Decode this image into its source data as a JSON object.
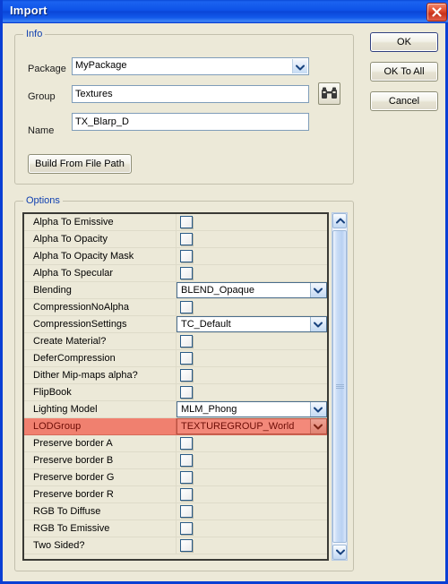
{
  "window": {
    "title": "Import",
    "close_icon": "close-x-icon"
  },
  "info": {
    "legend": "Info",
    "package": {
      "label": "Package",
      "value": "MyPackage",
      "icon": "chevron-down-icon"
    },
    "group": {
      "label": "Group",
      "value": "Textures",
      "browse_icon": "binoculars-icon"
    },
    "name": {
      "label": "Name",
      "value": "TX_Blarp_D"
    },
    "build_button": "Build From File Path"
  },
  "actions": {
    "ok": "OK",
    "ok_to_all": "OK To All",
    "cancel": "Cancel"
  },
  "options": {
    "legend": "Options",
    "rows": [
      {
        "name": "Alpha To Emissive",
        "type": "checkbox",
        "checked": false
      },
      {
        "name": "Alpha To Opacity",
        "type": "checkbox",
        "checked": false
      },
      {
        "name": "Alpha To Opacity Mask",
        "type": "checkbox",
        "checked": false
      },
      {
        "name": "Alpha To Specular",
        "type": "checkbox",
        "checked": false
      },
      {
        "name": "Blending",
        "type": "combo",
        "value": "BLEND_Opaque"
      },
      {
        "name": "CompressionNoAlpha",
        "type": "checkbox",
        "checked": false
      },
      {
        "name": "CompressionSettings",
        "type": "combo",
        "value": "TC_Default"
      },
      {
        "name": "Create Material?",
        "type": "checkbox",
        "checked": false
      },
      {
        "name": "DeferCompression",
        "type": "checkbox",
        "checked": false
      },
      {
        "name": "Dither Mip-maps alpha?",
        "type": "checkbox",
        "checked": false
      },
      {
        "name": "FlipBook",
        "type": "checkbox",
        "checked": false
      },
      {
        "name": "Lighting Model",
        "type": "combo",
        "value": "MLM_Phong"
      },
      {
        "name": "LODGroup",
        "type": "combo",
        "value": "TEXTUREGROUP_World",
        "selected": true
      },
      {
        "name": "Preserve border A",
        "type": "checkbox",
        "checked": false
      },
      {
        "name": "Preserve border B",
        "type": "checkbox",
        "checked": false
      },
      {
        "name": "Preserve border G",
        "type": "checkbox",
        "checked": false
      },
      {
        "name": "Preserve border R",
        "type": "checkbox",
        "checked": false
      },
      {
        "name": "RGB To Diffuse",
        "type": "checkbox",
        "checked": false
      },
      {
        "name": "RGB To Emissive",
        "type": "checkbox",
        "checked": false
      },
      {
        "name": "Two Sided?",
        "type": "checkbox",
        "checked": false
      }
    ],
    "scrollbar": {
      "up_icon": "chevron-up-icon",
      "down_icon": "chevron-down-icon",
      "grip_icon": "grip-lines-icon"
    }
  },
  "colors": {
    "title_blue": "#0e53e8",
    "face": "#ece9d8",
    "legend_text": "#1040b0",
    "highlight_row": "#f0806f",
    "highlight_text": "#6d0d06"
  }
}
